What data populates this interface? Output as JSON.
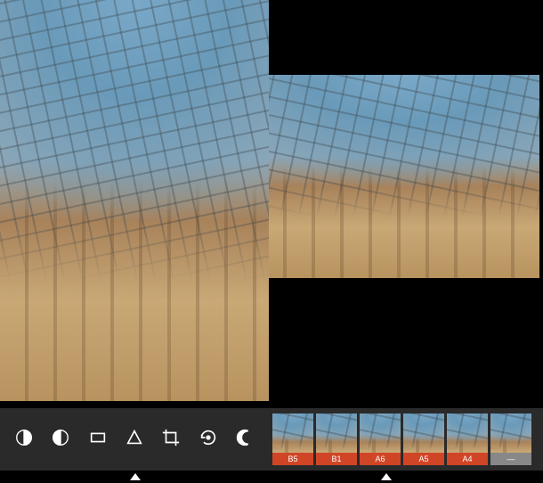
{
  "toolbar": {
    "brightness": "brightness",
    "contrast": "contrast",
    "aspect": "aspect",
    "sharpen": "sharpen",
    "crop": "crop",
    "rotate": "rotate",
    "exposure": "exposure"
  },
  "filters": [
    {
      "label": "B5"
    },
    {
      "label": "B1"
    },
    {
      "label": "A6"
    },
    {
      "label": "A5"
    },
    {
      "label": "A4"
    },
    {
      "label": "—",
      "none": true
    }
  ]
}
